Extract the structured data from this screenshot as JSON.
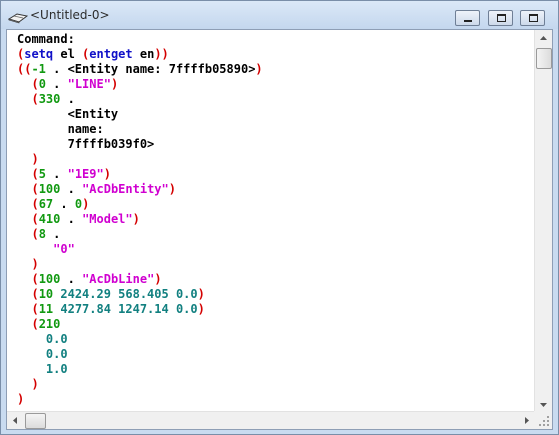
{
  "window": {
    "title": "<Untitled-0>",
    "icon": "lisp-console-icon",
    "buttons": [
      "minimize-icon",
      "restore-icon",
      "close-icon"
    ]
  },
  "console": {
    "lines": [
      [
        {
          "t": "Command:",
          "c": "blk"
        }
      ],
      [
        {
          "t": "(",
          "c": "red"
        },
        {
          "t": "setq",
          "c": "blue"
        },
        {
          "t": " el ",
          "c": "blk"
        },
        {
          "t": "(",
          "c": "red"
        },
        {
          "t": "entget",
          "c": "blue"
        },
        {
          "t": " en",
          "c": "blk"
        },
        {
          "t": "))",
          "c": "red"
        }
      ],
      [
        {
          "t": "((",
          "c": "red"
        },
        {
          "t": "-1",
          "c": "grn"
        },
        {
          "t": " . <Entity name: 7ffffb05890>",
          "c": "blk"
        },
        {
          "t": ")",
          "c": "red"
        }
      ],
      [
        {
          "t": "  (",
          "c": "red"
        },
        {
          "t": "0",
          "c": "grn"
        },
        {
          "t": " . ",
          "c": "blk"
        },
        {
          "t": "\"LINE\"",
          "c": "mag"
        },
        {
          "t": ")",
          "c": "red"
        }
      ],
      [
        {
          "t": "  (",
          "c": "red"
        },
        {
          "t": "330",
          "c": "grn"
        },
        {
          "t": " .",
          "c": "blk"
        }
      ],
      [
        {
          "t": "       <Entity",
          "c": "blk"
        }
      ],
      [
        {
          "t": "       name:",
          "c": "blk"
        }
      ],
      [
        {
          "t": "       7ffffb039f0>",
          "c": "blk"
        }
      ],
      [
        {
          "t": "  )",
          "c": "red"
        }
      ],
      [
        {
          "t": "  (",
          "c": "red"
        },
        {
          "t": "5",
          "c": "grn"
        },
        {
          "t": " . ",
          "c": "blk"
        },
        {
          "t": "\"1E9\"",
          "c": "mag"
        },
        {
          "t": ")",
          "c": "red"
        }
      ],
      [
        {
          "t": "  (",
          "c": "red"
        },
        {
          "t": "100",
          "c": "grn"
        },
        {
          "t": " . ",
          "c": "blk"
        },
        {
          "t": "\"AcDbEntity\"",
          "c": "mag"
        },
        {
          "t": ")",
          "c": "red"
        }
      ],
      [
        {
          "t": "  (",
          "c": "red"
        },
        {
          "t": "67",
          "c": "grn"
        },
        {
          "t": " . ",
          "c": "blk"
        },
        {
          "t": "0",
          "c": "grn"
        },
        {
          "t": ")",
          "c": "red"
        }
      ],
      [
        {
          "t": "  (",
          "c": "red"
        },
        {
          "t": "410",
          "c": "grn"
        },
        {
          "t": " . ",
          "c": "blk"
        },
        {
          "t": "\"Model\"",
          "c": "mag"
        },
        {
          "t": ")",
          "c": "red"
        }
      ],
      [
        {
          "t": "  (",
          "c": "red"
        },
        {
          "t": "8",
          "c": "grn"
        },
        {
          "t": " .",
          "c": "blk"
        }
      ],
      [
        {
          "t": "     \"0\"",
          "c": "mag"
        }
      ],
      [
        {
          "t": "  )",
          "c": "red"
        }
      ],
      [
        {
          "t": "  (",
          "c": "red"
        },
        {
          "t": "100",
          "c": "grn"
        },
        {
          "t": " . ",
          "c": "blk"
        },
        {
          "t": "\"AcDbLine\"",
          "c": "mag"
        },
        {
          "t": ")",
          "c": "red"
        }
      ],
      [
        {
          "t": "  (",
          "c": "red"
        },
        {
          "t": "10",
          "c": "grn"
        },
        {
          "t": " 2424.29 568.405 0.0",
          "c": "teal"
        },
        {
          "t": ")",
          "c": "red"
        }
      ],
      [
        {
          "t": "  (",
          "c": "red"
        },
        {
          "t": "11",
          "c": "grn"
        },
        {
          "t": " 4277.84 1247.14 0.0",
          "c": "teal"
        },
        {
          "t": ")",
          "c": "red"
        }
      ],
      [
        {
          "t": "  (",
          "c": "red"
        },
        {
          "t": "210",
          "c": "grn"
        }
      ],
      [
        {
          "t": "    0.0",
          "c": "teal"
        }
      ],
      [
        {
          "t": "    0.0",
          "c": "teal"
        }
      ],
      [
        {
          "t": "    1.0",
          "c": "teal"
        }
      ],
      [
        {
          "t": "  )",
          "c": "red"
        }
      ],
      [
        {
          "t": ")",
          "c": "red"
        }
      ]
    ]
  },
  "scrollbars": {
    "vertical_position": 0,
    "horizontal_position": 0
  },
  "colors": {
    "paren": "#d40000",
    "function": "#1010c8",
    "integer": "#119911",
    "real": "#128080",
    "string": "#d000d0",
    "text": "#000000"
  }
}
